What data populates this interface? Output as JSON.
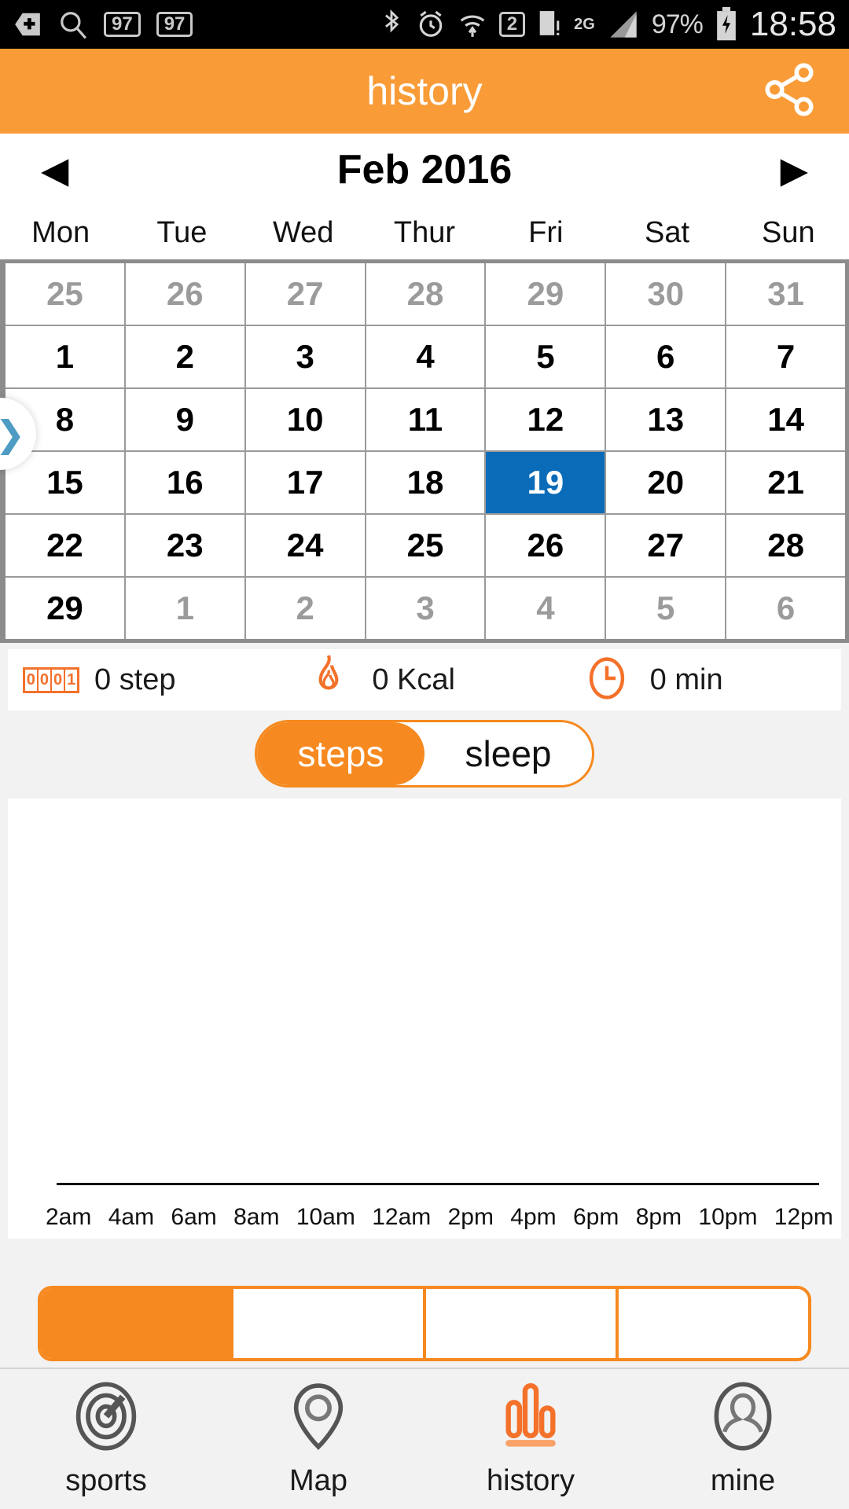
{
  "statusbar": {
    "icons_left": [
      "back-plus-icon",
      "search-icon"
    ],
    "badge1": "97",
    "badge2": "97",
    "bluetooth": "bluetooth-icon",
    "alarm": "alarm-icon",
    "wifi": "wifi-icon",
    "sim": "2",
    "network_type": "2G",
    "battery_percent": "97%",
    "time": "18:58"
  },
  "header": {
    "title": "history",
    "share_icon": "share-icon"
  },
  "monthnav": {
    "prev_icon": "◀",
    "label": "Feb 2016",
    "next_icon": "▶"
  },
  "calendar": {
    "weekdays": [
      "Mon",
      "Tue",
      "Wed",
      "Thur",
      "Fri",
      "Sat",
      "Sun"
    ],
    "selected_day": "19",
    "selected_color": "#0A6CB8",
    "edge_handle_icon": "chevron-right-icon",
    "rows": [
      [
        {
          "d": "25",
          "muted": true
        },
        {
          "d": "26",
          "muted": true
        },
        {
          "d": "27",
          "muted": true
        },
        {
          "d": "28",
          "muted": true
        },
        {
          "d": "29",
          "muted": true
        },
        {
          "d": "30",
          "muted": true
        },
        {
          "d": "31",
          "muted": true
        }
      ],
      [
        {
          "d": "1"
        },
        {
          "d": "2"
        },
        {
          "d": "3"
        },
        {
          "d": "4"
        },
        {
          "d": "5"
        },
        {
          "d": "6"
        },
        {
          "d": "7"
        }
      ],
      [
        {
          "d": "8"
        },
        {
          "d": "9"
        },
        {
          "d": "10"
        },
        {
          "d": "11"
        },
        {
          "d": "12"
        },
        {
          "d": "13"
        },
        {
          "d": "14"
        }
      ],
      [
        {
          "d": "15"
        },
        {
          "d": "16"
        },
        {
          "d": "17"
        },
        {
          "d": "18"
        },
        {
          "d": "19",
          "selected": true
        },
        {
          "d": "20"
        },
        {
          "d": "21"
        }
      ],
      [
        {
          "d": "22"
        },
        {
          "d": "23"
        },
        {
          "d": "24"
        },
        {
          "d": "25"
        },
        {
          "d": "26"
        },
        {
          "d": "27"
        },
        {
          "d": "28"
        }
      ],
      [
        {
          "d": "29"
        },
        {
          "d": "1",
          "muted": true
        },
        {
          "d": "2",
          "muted": true
        },
        {
          "d": "3",
          "muted": true
        },
        {
          "d": "4",
          "muted": true
        },
        {
          "d": "5",
          "muted": true
        },
        {
          "d": "6",
          "muted": true
        }
      ]
    ]
  },
  "stats": [
    {
      "icon": "step-counter-icon",
      "value": "0 step"
    },
    {
      "icon": "flame-icon",
      "value": "0 Kcal"
    },
    {
      "icon": "clock-icon",
      "value": "0 min"
    }
  ],
  "toggle": {
    "options": [
      "steps",
      "sleep"
    ],
    "selected": "steps",
    "accent": "#F6891F"
  },
  "chart_data": {
    "type": "bar",
    "title": "",
    "xlabel": "",
    "ylabel": "",
    "categories": [
      "2am",
      "4am",
      "6am",
      "8am",
      "10am",
      "12am",
      "2pm",
      "4pm",
      "6pm",
      "8pm",
      "10pm",
      "12pm"
    ],
    "values": [
      0,
      0,
      0,
      0,
      0,
      0,
      0,
      0,
      0,
      0,
      0,
      0
    ],
    "ylim": [
      0,
      0
    ],
    "grid": false,
    "legend": "none"
  },
  "segmented": {
    "options": [
      "",
      "",
      "",
      ""
    ],
    "selected_index": 0,
    "accent": "#F6891F"
  },
  "bottomnav": {
    "items": [
      {
        "icon": "sports-target-icon",
        "label": "sports",
        "active": false
      },
      {
        "icon": "map-pin-icon",
        "label": "Map",
        "active": false
      },
      {
        "icon": "history-bars-icon",
        "label": "history",
        "active": true
      },
      {
        "icon": "person-icon",
        "label": "mine",
        "active": false
      }
    ],
    "active_color": "#F4712A"
  }
}
